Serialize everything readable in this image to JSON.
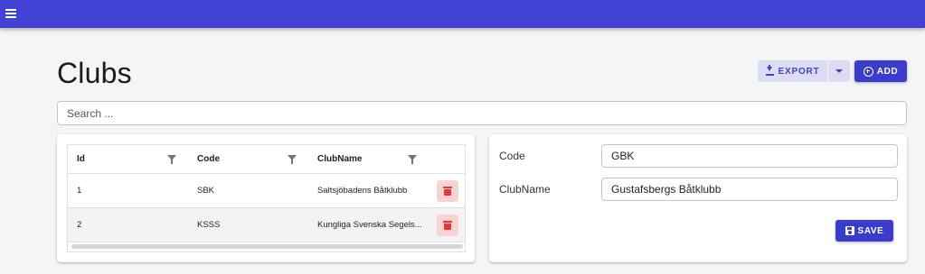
{
  "appbar": {
    "menu_icon": "hamburger-menu-icon"
  },
  "page": {
    "title": "Clubs"
  },
  "toolbar": {
    "export_label": "EXPORT",
    "add_label": "ADD",
    "colors": {
      "primary": "#3b3bcc",
      "appbar": "#4141d4",
      "secondary_bg": "#dcdcf4"
    }
  },
  "search": {
    "placeholder": "Search ...",
    "value": ""
  },
  "grid": {
    "columns": [
      {
        "label": "Id",
        "filter_icon": "filter-icon"
      },
      {
        "label": "Code",
        "filter_icon": "filter-icon"
      },
      {
        "label": "ClubName",
        "filter_icon": "filter-icon"
      }
    ],
    "rows": [
      {
        "id": "1",
        "code": "SBK",
        "club_name": "Saltsjöbadens Båtklubb",
        "delete_icon": "trash-icon"
      },
      {
        "id": "2",
        "code": "KSSS",
        "club_name": "Kungliga Svenska Segels...",
        "delete_icon": "trash-icon"
      }
    ]
  },
  "form": {
    "code_label": "Code",
    "code_value": "GBK",
    "club_name_label": "ClubName",
    "club_name_value": "Gustafsbergs Båtklubb",
    "save_label": "SAVE"
  }
}
